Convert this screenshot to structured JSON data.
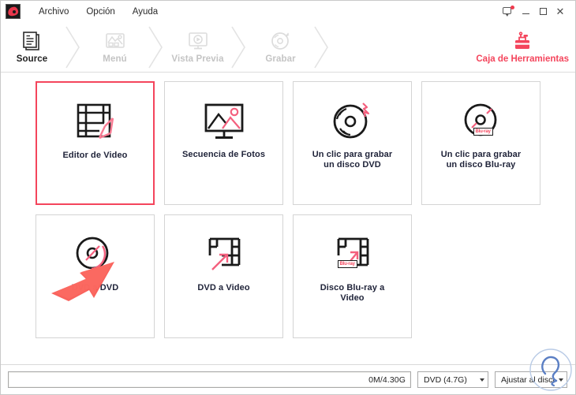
{
  "window": {
    "logo": "app-logo",
    "menu": [
      "Archivo",
      "Opción",
      "Ayuda"
    ],
    "controls": {
      "feedback": "feedback-icon",
      "minimize": "–",
      "maximize": "□",
      "close": "✕"
    }
  },
  "toolbar": {
    "steps": [
      {
        "label": "Source",
        "icon": "document-stack-icon",
        "state": "active"
      },
      {
        "label": "Menú",
        "icon": "image-gallery-icon",
        "state": "disabled"
      },
      {
        "label": "Vista Previa",
        "icon": "monitor-play-icon",
        "state": "disabled"
      },
      {
        "label": "Grabar",
        "icon": "disc-burn-icon",
        "state": "disabled"
      }
    ],
    "toolbox": {
      "label": "Caja de Herramientas",
      "icon": "toolbox-icon",
      "color": "#f4455c"
    }
  },
  "main": {
    "cards": [
      {
        "label": "Editor de Video",
        "icon": "film-strip-pencil-icon",
        "selected": true
      },
      {
        "label": "Secuencia de Fotos",
        "icon": "monitor-photo-icon",
        "selected": false
      },
      {
        "label": "Un clic para grabar\nun disco DVD",
        "icon": "disc-lightning-icon",
        "selected": false
      },
      {
        "label": "Un clic para grabar\nun disco Blu-ray",
        "icon": "disc-bluray-icon",
        "selected": false
      },
      {
        "label": "DVD a DVD",
        "icon": "disc-copy-icon",
        "selected": false
      },
      {
        "label": "DVD a Video",
        "icon": "film-strip-arrow-icon",
        "selected": false
      },
      {
        "label": "Disco Blu-ray a\nVideo",
        "icon": "film-strip-bluray-icon",
        "selected": false
      }
    ],
    "annotation": {
      "name": "red-arrow-pointer",
      "color": "#f9564f"
    }
  },
  "statusbar": {
    "progress_value": 0,
    "size_text": "0M/4.30G",
    "disc_type": "DVD (4.7G)",
    "fit_mode": "Ajustar al disco"
  },
  "watermark": {
    "name": "blue-circle-watermark",
    "color": "#5b7fc4"
  },
  "colors": {
    "accent": "#f4455c",
    "text": "#20243a",
    "disabled": "#c4c4c4",
    "border": "#d4d4d4",
    "annotation": "#f9564f"
  }
}
